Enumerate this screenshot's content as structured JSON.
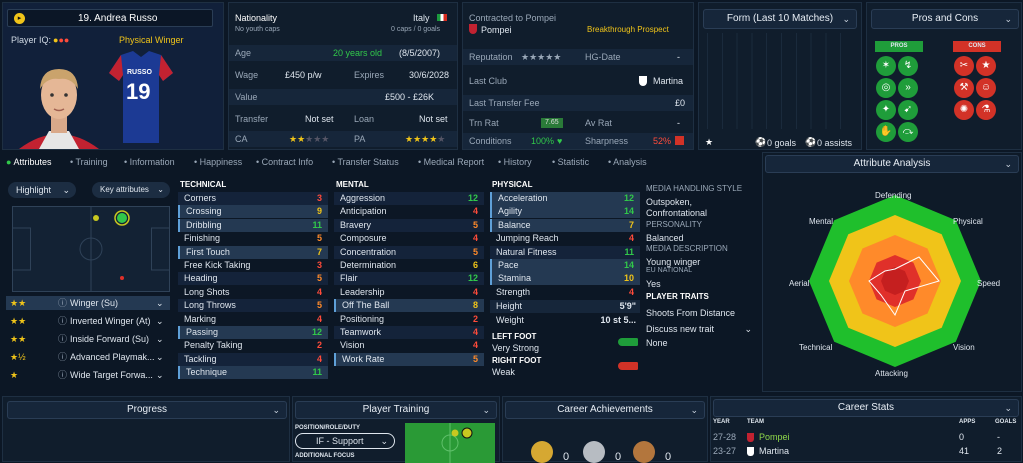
{
  "profile": {
    "number_name": "19. Andrea Russo",
    "player_iq_label": "Player IQ:",
    "role": "Physical Winger",
    "shirt_name": "RUSSO",
    "shirt_number": "19"
  },
  "info": {
    "nationality_label": "Nationality",
    "nationality": "Italy",
    "youth_caps": "No youth caps",
    "caps": "0 caps / 0 goals",
    "age_label": "Age",
    "age": "20 years old",
    "dob": "(8/5/2007)",
    "wage_label": "Wage",
    "wage": "£450 p/w",
    "expires_label": "Expires",
    "expires": "30/6/2028",
    "value_label": "Value",
    "value": "£500 - £26K",
    "transfer_label": "Transfer",
    "transfer": "Not set",
    "loan_label": "Loan",
    "loan": "Not set",
    "ca_label": "CA",
    "pa_label": "PA"
  },
  "contract": {
    "contracted_label": "Contracted to Pompei",
    "club": "Pompei",
    "tag": "Breakthrough Prospect",
    "reputation_label": "Reputation",
    "hg_label": "HG-Date",
    "hg_value": "-",
    "last_club_label": "Last Club",
    "last_club": "Martina",
    "last_fee_label": "Last Transfer Fee",
    "last_fee": "£0",
    "trn_rat_label": "Trn Rat",
    "trn_rat": "7.65",
    "av_rat_label": "Av Rat",
    "av_rat": "-",
    "conditions_label": "Conditions",
    "conditions": "100%",
    "sharpness_label": "Sharpness",
    "sharpness": "52%"
  },
  "form": {
    "title": "Form (Last 10 Matches)",
    "goals": "0 goals",
    "assists": "0 assists"
  },
  "pros_cons": {
    "title": "Pros and Cons",
    "pros": "PROS",
    "cons": "CONS"
  },
  "tabs": [
    "Attributes",
    "Training",
    "Information",
    "Happiness",
    "Contract Info",
    "Transfer Status",
    "Medical Report",
    "History",
    "Statistic",
    "Analysis"
  ],
  "left": {
    "highlight": "Highlight",
    "key_attrs": "Key attributes",
    "roles": [
      {
        "name": "Winger (Su)",
        "stars": "★★"
      },
      {
        "name": "Inverted Winger (At)",
        "stars": "★★"
      },
      {
        "name": "Inside Forward (Su)",
        "stars": "★★"
      },
      {
        "name": "Advanced Playmak...",
        "stars": "★½"
      },
      {
        "name": "Wide Target Forwa...",
        "stars": "★"
      }
    ]
  },
  "technical": {
    "title": "TECHNICAL",
    "items": [
      {
        "name": "Corners",
        "v": "3",
        "c": "r",
        "hl": false
      },
      {
        "name": "Crossing",
        "v": "9",
        "c": "y",
        "hl": true
      },
      {
        "name": "Dribbling",
        "v": "11",
        "c": "g",
        "hl": true
      },
      {
        "name": "Finishing",
        "v": "5",
        "c": "o",
        "hl": false
      },
      {
        "name": "First Touch",
        "v": "7",
        "c": "y",
        "hl": true
      },
      {
        "name": "Free Kick Taking",
        "v": "3",
        "c": "r",
        "hl": false
      },
      {
        "name": "Heading",
        "v": "5",
        "c": "o",
        "hl": false
      },
      {
        "name": "Long Shots",
        "v": "4",
        "c": "r",
        "hl": false
      },
      {
        "name": "Long Throws",
        "v": "5",
        "c": "o",
        "hl": false
      },
      {
        "name": "Marking",
        "v": "4",
        "c": "r",
        "hl": false
      },
      {
        "name": "Passing",
        "v": "12",
        "c": "g",
        "hl": true
      },
      {
        "name": "Penalty Taking",
        "v": "2",
        "c": "r",
        "hl": false
      },
      {
        "name": "Tackling",
        "v": "4",
        "c": "r",
        "hl": false
      },
      {
        "name": "Technique",
        "v": "11",
        "c": "g",
        "hl": true
      }
    ]
  },
  "mental": {
    "title": "MENTAL",
    "items": [
      {
        "name": "Aggression",
        "v": "12",
        "c": "g",
        "hl": false
      },
      {
        "name": "Anticipation",
        "v": "4",
        "c": "r",
        "hl": false
      },
      {
        "name": "Bravery",
        "v": "5",
        "c": "o",
        "hl": false
      },
      {
        "name": "Composure",
        "v": "4",
        "c": "r",
        "hl": false
      },
      {
        "name": "Concentration",
        "v": "5",
        "c": "o",
        "hl": false
      },
      {
        "name": "Determination",
        "v": "6",
        "c": "y",
        "hl": false
      },
      {
        "name": "Flair",
        "v": "12",
        "c": "g",
        "hl": false
      },
      {
        "name": "Leadership",
        "v": "4",
        "c": "r",
        "hl": false
      },
      {
        "name": "Off The Ball",
        "v": "8",
        "c": "y",
        "hl": true
      },
      {
        "name": "Positioning",
        "v": "2",
        "c": "r",
        "hl": false
      },
      {
        "name": "Teamwork",
        "v": "4",
        "c": "r",
        "hl": false
      },
      {
        "name": "Vision",
        "v": "4",
        "c": "r",
        "hl": false
      },
      {
        "name": "Work Rate",
        "v": "5",
        "c": "o",
        "hl": true
      }
    ]
  },
  "physical": {
    "title": "PHYSICAL",
    "items": [
      {
        "name": "Acceleration",
        "v": "12",
        "c": "g",
        "hl": true
      },
      {
        "name": "Agility",
        "v": "14",
        "c": "g",
        "hl": true
      },
      {
        "name": "Balance",
        "v": "7",
        "c": "y",
        "hl": true
      },
      {
        "name": "Jumping Reach",
        "v": "4",
        "c": "r",
        "hl": false
      },
      {
        "name": "Natural Fitness",
        "v": "11",
        "c": "g",
        "hl": false
      },
      {
        "name": "Pace",
        "v": "14",
        "c": "g",
        "hl": true
      },
      {
        "name": "Stamina",
        "v": "10",
        "c": "y",
        "hl": true
      },
      {
        "name": "Strength",
        "v": "4",
        "c": "r",
        "hl": false
      }
    ],
    "height_label": "Height",
    "height": "5'9\"",
    "weight_label": "Weight",
    "weight": "10 st 5...",
    "left_foot_label": "LEFT FOOT",
    "left_foot": "Very Strong",
    "right_foot_label": "RIGHT FOOT",
    "right_foot": "Weak"
  },
  "media": {
    "style_label": "MEDIA HANDLING STYLE",
    "style": "Outspoken, Confrontational",
    "personality_label": "PERSONALITY",
    "personality": "Balanced",
    "desc_label": "MEDIA DESCRIPTION",
    "desc": "Young winger",
    "eu_label": "EU NATIONAL",
    "eu": "Yes",
    "traits_label": "PLAYER TRAITS",
    "trait1": "Shoots From Distance",
    "discuss": "Discuss new trait",
    "none": "None"
  },
  "analysis": {
    "title": "Attribute Analysis",
    "labels": [
      "Defending",
      "Physical",
      "Speed",
      "Vision",
      "Attacking",
      "Technical",
      "Aerial",
      "Mental"
    ]
  },
  "bottom": {
    "progress": "Progress",
    "training": "Player Training",
    "pos_label": "POSITION/ROLE/DUTY",
    "pos_value": "IF - Support",
    "add_focus": "ADDITIONAL FOCUS",
    "achievements": "Career Achievements",
    "ach": [
      "0",
      "0",
      "0"
    ],
    "stats": "Career Stats",
    "year_h": "YEAR",
    "team_h": "TEAM",
    "apps_h": "APPS",
    "goals_h": "GOALS",
    "rows": [
      {
        "year": "27-28",
        "team": "Pompei",
        "apps": "0",
        "goals": "-"
      },
      {
        "year": "23-27",
        "team": "Martina",
        "apps": "41",
        "goals": "2"
      }
    ]
  },
  "colors": {
    "green": "#31c84a",
    "yellow": "#f0c419",
    "orange": "#ff8a2a",
    "red": "#ff4b3a"
  }
}
